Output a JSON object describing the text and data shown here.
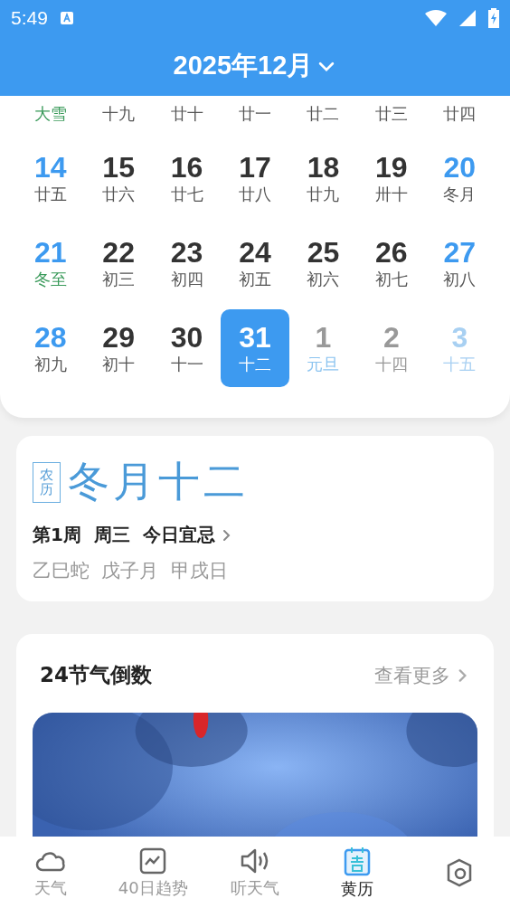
{
  "status_bar": {
    "time": "5:49"
  },
  "header": {
    "title": "2025年12月"
  },
  "calendar": {
    "rows": [
      {
        "cells": [
          {
            "lunar": "大雪",
            "solar_term": true,
            "holiday": false
          },
          {
            "lunar": "十九",
            "solar_term": false,
            "holiday": false
          },
          {
            "lunar": "廿十",
            "solar_term": false,
            "holiday": false
          },
          {
            "lunar": "廿一",
            "solar_term": false,
            "holiday": false
          },
          {
            "lunar": "廿二",
            "solar_term": false,
            "holiday": false
          },
          {
            "lunar": "廿三",
            "solar_term": false,
            "holiday": false
          },
          {
            "lunar": "廿四",
            "solar_term": false,
            "holiday": false
          }
        ]
      },
      {
        "cells": [
          {
            "date": "14",
            "lunar": "廿五",
            "kind": "weekend",
            "solar_term": false,
            "holiday": false,
            "selected": false
          },
          {
            "date": "15",
            "lunar": "廿六",
            "kind": "weekday",
            "solar_term": false,
            "holiday": false,
            "selected": false
          },
          {
            "date": "16",
            "lunar": "廿七",
            "kind": "weekday",
            "solar_term": false,
            "holiday": false,
            "selected": false
          },
          {
            "date": "17",
            "lunar": "廿八",
            "kind": "weekday",
            "solar_term": false,
            "holiday": false,
            "selected": false
          },
          {
            "date": "18",
            "lunar": "廿九",
            "kind": "weekday",
            "solar_term": false,
            "holiday": false,
            "selected": false
          },
          {
            "date": "19",
            "lunar": "卅十",
            "kind": "weekday",
            "solar_term": false,
            "holiday": false,
            "selected": false
          },
          {
            "date": "20",
            "lunar": "冬月",
            "kind": "weekend",
            "solar_term": false,
            "holiday": false,
            "selected": false
          }
        ]
      },
      {
        "cells": [
          {
            "date": "21",
            "lunar": "冬至",
            "kind": "weekend",
            "solar_term": true,
            "holiday": false,
            "selected": false
          },
          {
            "date": "22",
            "lunar": "初三",
            "kind": "weekday",
            "solar_term": false,
            "holiday": false,
            "selected": false
          },
          {
            "date": "23",
            "lunar": "初四",
            "kind": "weekday",
            "solar_term": false,
            "holiday": false,
            "selected": false
          },
          {
            "date": "24",
            "lunar": "初五",
            "kind": "weekday",
            "solar_term": false,
            "holiday": false,
            "selected": false
          },
          {
            "date": "25",
            "lunar": "初六",
            "kind": "weekday",
            "solar_term": false,
            "holiday": false,
            "selected": false
          },
          {
            "date": "26",
            "lunar": "初七",
            "kind": "weekday",
            "solar_term": false,
            "holiday": false,
            "selected": false
          },
          {
            "date": "27",
            "lunar": "初八",
            "kind": "weekend",
            "solar_term": false,
            "holiday": false,
            "selected": false
          }
        ]
      },
      {
        "cells": [
          {
            "date": "28",
            "lunar": "初九",
            "kind": "weekend",
            "solar_term": false,
            "holiday": false,
            "selected": false
          },
          {
            "date": "29",
            "lunar": "初十",
            "kind": "weekday",
            "solar_term": false,
            "holiday": false,
            "selected": false
          },
          {
            "date": "30",
            "lunar": "十一",
            "kind": "weekday",
            "solar_term": false,
            "holiday": false,
            "selected": false
          },
          {
            "date": "31",
            "lunar": "十二",
            "kind": "weekday",
            "solar_term": false,
            "holiday": false,
            "selected": true
          },
          {
            "date": "1",
            "lunar": "元旦",
            "kind": "other_month",
            "solar_term": false,
            "holiday": true,
            "selected": false
          },
          {
            "date": "2",
            "lunar": "十四",
            "kind": "other_month",
            "solar_term": false,
            "holiday": false,
            "selected": false
          },
          {
            "date": "3",
            "lunar": "十五",
            "kind": "other_month_weekend",
            "solar_term": false,
            "holiday": false,
            "selected": false
          }
        ]
      }
    ]
  },
  "lunar_card": {
    "badge": "农历",
    "date": "冬月十二",
    "week_line": "第1周  周三  今日宜忌",
    "ganzhi": "乙巳蛇  戊子月  甲戌日"
  },
  "solar_terms": {
    "title": "24节气倒数",
    "more": "查看更多"
  },
  "bottom_nav": [
    {
      "label": "天气",
      "selected": false
    },
    {
      "label": "40日趋势",
      "selected": false
    },
    {
      "label": "听天气",
      "selected": false
    },
    {
      "label": "黄历",
      "selected": true
    },
    {
      "selected": false
    }
  ]
}
